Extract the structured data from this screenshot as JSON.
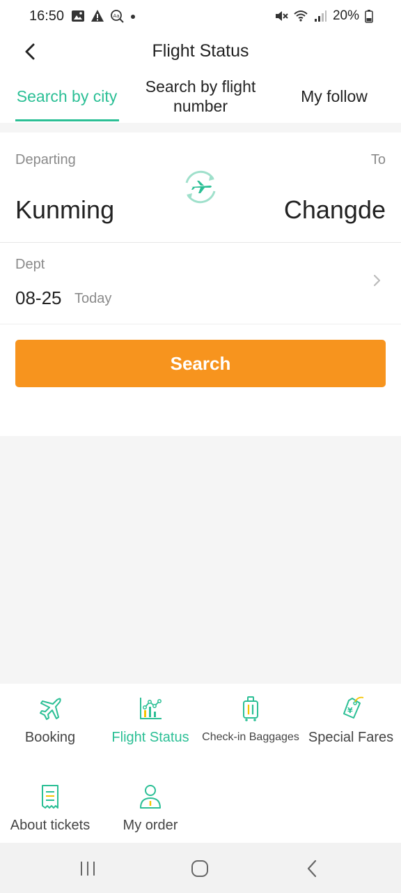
{
  "status_bar": {
    "time": "16:50",
    "battery": "20%",
    "left_icons": [
      "image-icon",
      "warning-icon",
      "search-text-icon",
      "dot-icon"
    ],
    "right_icons": [
      "mute-icon",
      "wifi-icon",
      "signal-icon",
      "battery-icon"
    ]
  },
  "header": {
    "title": "Flight Status",
    "back_icon": "chevron-left-icon"
  },
  "tabs": [
    {
      "label": "Search by city",
      "active": true
    },
    {
      "label": "Search by flight number",
      "active": false
    },
    {
      "label": "My follow",
      "active": false
    }
  ],
  "route": {
    "departing_label": "Departing",
    "to_label": "To",
    "from_city": "Kunming",
    "to_city": "Changde",
    "swap_icon": "plane-swap-icon"
  },
  "date": {
    "label": "Dept",
    "value": "08-25",
    "day": "Today"
  },
  "search_button": "Search",
  "menu": [
    {
      "label": "Booking",
      "icon": "plane-icon",
      "active": false
    },
    {
      "label": "Flight Status",
      "icon": "chart-icon",
      "active": true
    },
    {
      "label": "Check-in Baggages",
      "icon": "luggage-icon",
      "active": false
    },
    {
      "label": "Special Fares",
      "icon": "price-tag-icon",
      "active": false
    },
    {
      "label": "About tickets",
      "icon": "receipt-icon",
      "active": false
    },
    {
      "label": "My order",
      "icon": "person-icon",
      "active": false
    }
  ],
  "colors": {
    "accent": "#2bbf95",
    "button": "#f7941e",
    "tag_accent": "#f5c400"
  },
  "nav_bar": [
    "recents-icon",
    "home-icon",
    "back-icon"
  ]
}
